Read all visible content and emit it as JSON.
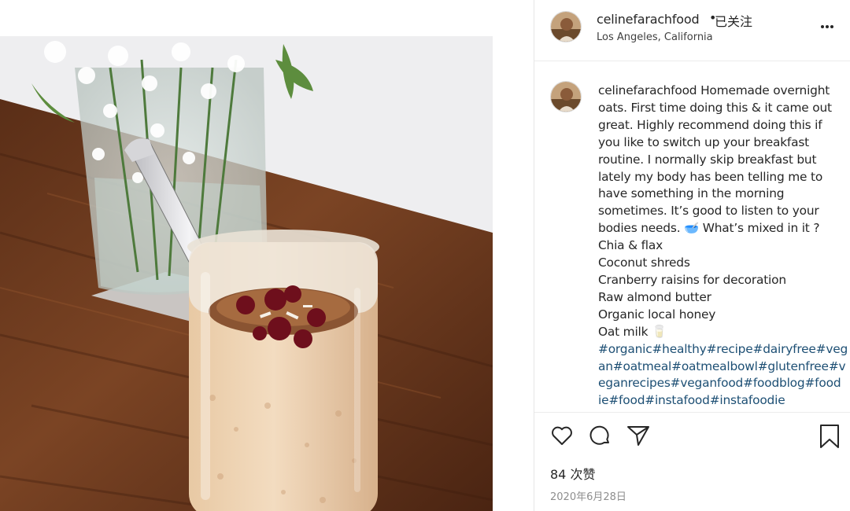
{
  "post": {
    "username": "celinefarachfood",
    "follow_status": "已关注",
    "separator": "•",
    "location": "Los Angeles, California",
    "more_icon": "ellipsis-horizontal-icon"
  },
  "caption": {
    "username": "celinefarachfood",
    "lines": [
      "Homemade overnight",
      "oats. First time doing this & it came out",
      "great. Highly recommend doing this if",
      "you like to switch up your breakfast",
      "routine. I normally skip breakfast but",
      "lately my body has been telling me to",
      "have something in the morning",
      "sometimes. It’s good to listen to your",
      "bodies needs. 🥣 What’s mixed in it ?",
      "Chia & flax",
      "Coconut shreds",
      "Cranberry raisins for decoration",
      "Raw almond butter",
      "Organic local honey",
      "Oat milk 🥛"
    ],
    "hashtag_lines": [
      "#organic#healthy#recipe#dairyfree#veg",
      "an#oatmeal#oatmealbowl#glutenfree#v",
      "eganrecipes#veganfood#foodblog#food",
      "ie#food#instafood#instafoodie"
    ]
  },
  "actions": {
    "like_icon": "heart-outline-icon",
    "comment_icon": "comment-bubble-icon",
    "share_icon": "paper-plane-icon",
    "save_icon": "bookmark-icon"
  },
  "likes": "84 次赞",
  "date": "2020年6月28日",
  "colors": {
    "hashtag": "#1d4f74",
    "text": "#262626",
    "muted": "#8e8e8e",
    "divider": "#ececec"
  }
}
